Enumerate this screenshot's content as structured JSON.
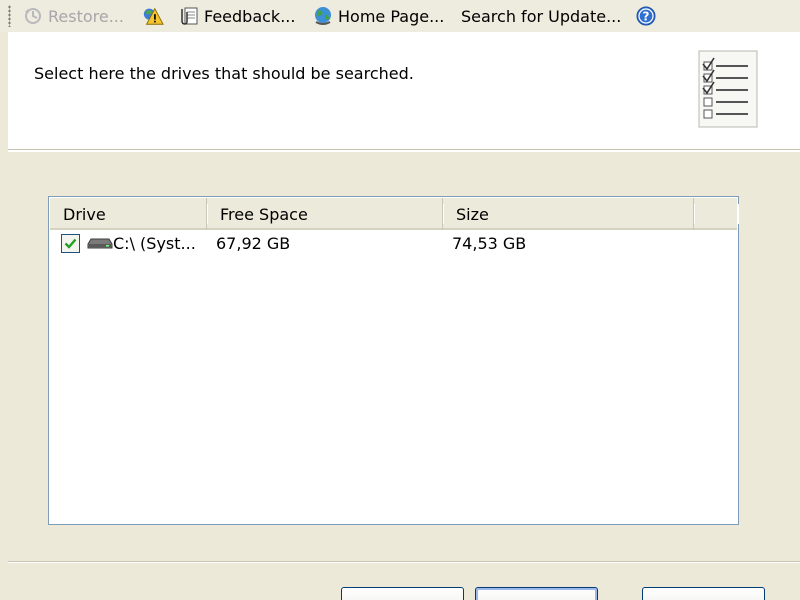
{
  "toolbar": {
    "items": [
      {
        "label": "Restore...",
        "icon": "restore-icon",
        "enabled": false
      },
      {
        "label": "",
        "icon": "warning-icon",
        "enabled": true
      },
      {
        "label": "Feedback...",
        "icon": "feedback-icon",
        "enabled": true
      },
      {
        "label": "Home Page...",
        "icon": "globe-icon",
        "enabled": true
      },
      {
        "label": "Search for Update...",
        "icon": "",
        "enabled": true
      },
      {
        "label": "",
        "icon": "help-icon",
        "enabled": true
      }
    ]
  },
  "header": {
    "instruction": "Select here the drives that should be searched.",
    "icon": "checklist-icon"
  },
  "drives_list": {
    "columns": [
      {
        "label": "Drive"
      },
      {
        "label": "Free Space"
      },
      {
        "label": "Size"
      }
    ],
    "rows": [
      {
        "checked": true,
        "icon": "hard-drive-icon",
        "drive": "C:\\ (Syst...",
        "free_space": "67,92 GB",
        "size": "74,53 GB"
      }
    ]
  },
  "colors": {
    "window_bg": "#ECE9D8",
    "header_bg": "#FFFFFF",
    "list_border": "#7F9DB9",
    "check_green": "#21A121"
  }
}
